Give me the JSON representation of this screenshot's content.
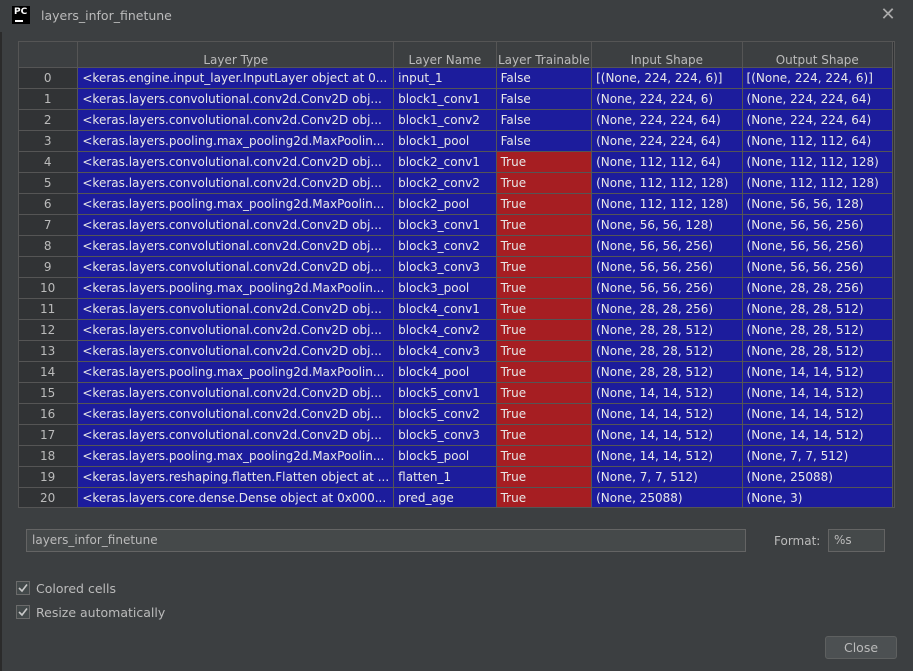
{
  "window": {
    "app_icon_text": "PC",
    "title": "layers_infor_finetune"
  },
  "table": {
    "columns": [
      "",
      "Layer Type",
      "Layer Name",
      "Layer Trainable",
      "Input Shape",
      "Output Shape"
    ],
    "rows": [
      [
        "0",
        "<keras.engine.input_layer.InputLayer object at 0...",
        "input_1",
        "False",
        "[(None, 224, 224, 6)]",
        "[(None, 224, 224, 6)]"
      ],
      [
        "1",
        "<keras.layers.convolutional.conv2d.Conv2D obj...",
        "block1_conv1",
        "False",
        "(None, 224, 224, 6)",
        "(None, 224, 224, 64)"
      ],
      [
        "2",
        "<keras.layers.convolutional.conv2d.Conv2D obj...",
        "block1_conv2",
        "False",
        "(None, 224, 224, 64)",
        "(None, 224, 224, 64)"
      ],
      [
        "3",
        "<keras.layers.pooling.max_pooling2d.MaxPoolin...",
        "block1_pool",
        "False",
        "(None, 224, 224, 64)",
        "(None, 112, 112, 64)"
      ],
      [
        "4",
        "<keras.layers.convolutional.conv2d.Conv2D obj...",
        "block2_conv1",
        "True",
        "(None, 112, 112, 64)",
        "(None, 112, 112, 128)"
      ],
      [
        "5",
        "<keras.layers.convolutional.conv2d.Conv2D obj...",
        "block2_conv2",
        "True",
        "(None, 112, 112, 128)",
        "(None, 112, 112, 128)"
      ],
      [
        "6",
        "<keras.layers.pooling.max_pooling2d.MaxPoolin...",
        "block2_pool",
        "True",
        "(None, 112, 112, 128)",
        "(None, 56, 56, 128)"
      ],
      [
        "7",
        "<keras.layers.convolutional.conv2d.Conv2D obj...",
        "block3_conv1",
        "True",
        "(None, 56, 56, 128)",
        "(None, 56, 56, 256)"
      ],
      [
        "8",
        "<keras.layers.convolutional.conv2d.Conv2D obj...",
        "block3_conv2",
        "True",
        "(None, 56, 56, 256)",
        "(None, 56, 56, 256)"
      ],
      [
        "9",
        "<keras.layers.convolutional.conv2d.Conv2D obj...",
        "block3_conv3",
        "True",
        "(None, 56, 56, 256)",
        "(None, 56, 56, 256)"
      ],
      [
        "10",
        "<keras.layers.pooling.max_pooling2d.MaxPoolin...",
        "block3_pool",
        "True",
        "(None, 56, 56, 256)",
        "(None, 28, 28, 256)"
      ],
      [
        "11",
        "<keras.layers.convolutional.conv2d.Conv2D obj...",
        "block4_conv1",
        "True",
        "(None, 28, 28, 256)",
        "(None, 28, 28, 512)"
      ],
      [
        "12",
        "<keras.layers.convolutional.conv2d.Conv2D obj...",
        "block4_conv2",
        "True",
        "(None, 28, 28, 512)",
        "(None, 28, 28, 512)"
      ],
      [
        "13",
        "<keras.layers.convolutional.conv2d.Conv2D obj...",
        "block4_conv3",
        "True",
        "(None, 28, 28, 512)",
        "(None, 28, 28, 512)"
      ],
      [
        "14",
        "<keras.layers.pooling.max_pooling2d.MaxPoolin...",
        "block4_pool",
        "True",
        "(None, 28, 28, 512)",
        "(None, 14, 14, 512)"
      ],
      [
        "15",
        "<keras.layers.convolutional.conv2d.Conv2D obj...",
        "block5_conv1",
        "True",
        "(None, 14, 14, 512)",
        "(None, 14, 14, 512)"
      ],
      [
        "16",
        "<keras.layers.convolutional.conv2d.Conv2D obj...",
        "block5_conv2",
        "True",
        "(None, 14, 14, 512)",
        "(None, 14, 14, 512)"
      ],
      [
        "17",
        "<keras.layers.convolutional.conv2d.Conv2D obj...",
        "block5_conv3",
        "True",
        "(None, 14, 14, 512)",
        "(None, 14, 14, 512)"
      ],
      [
        "18",
        "<keras.layers.pooling.max_pooling2d.MaxPoolin...",
        "block5_pool",
        "True",
        "(None, 14, 14, 512)",
        "(None, 7, 7, 512)"
      ],
      [
        "19",
        "<keras.layers.reshaping.flatten.Flatten object at ...",
        "flatten_1",
        "True",
        "(None, 7, 7, 512)",
        "(None, 25088)"
      ],
      [
        "20",
        "<keras.layers.core.dense.Dense object at 0x000...",
        "pred_age",
        "True",
        "(None, 25088)",
        "(None, 3)"
      ]
    ],
    "colors": {
      "cell_blue": "#1c1c9c",
      "cell_red": "#a61e22"
    }
  },
  "name_field": {
    "value": "layers_infor_finetune"
  },
  "format": {
    "label": "Format:",
    "value": "%s"
  },
  "options": {
    "colored_cells_label": "Colored cells",
    "colored_cells_checked": true,
    "resize_auto_label": "Resize automatically",
    "resize_auto_checked": true
  },
  "buttons": {
    "close_label": "Close"
  },
  "icons": {
    "app": "pycharm-logo-icon",
    "window_close": "close-icon",
    "checkbox": "checkmark-icon"
  }
}
